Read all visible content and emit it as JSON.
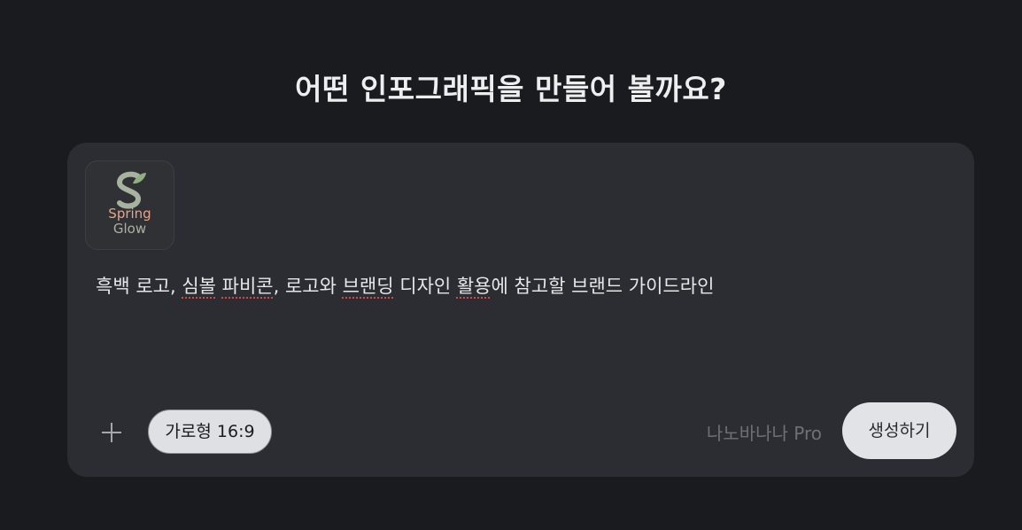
{
  "heading": "어떤 인포그래픽을 만들어 볼까요?",
  "attachment": {
    "logo_line1": "Spring",
    "logo_line2": "Glow",
    "colors": {
      "peach": "#e9a38c",
      "sage": "#a8b2a0",
      "leaf": "#8fb083"
    }
  },
  "prompt": {
    "segments": [
      {
        "text": "흑백 로고, ",
        "misspelled": false
      },
      {
        "text": "심볼",
        "misspelled": true
      },
      {
        "text": " ",
        "misspelled": false
      },
      {
        "text": "파비콘",
        "misspelled": true
      },
      {
        "text": ", 로고와 ",
        "misspelled": false
      },
      {
        "text": "브랜딩",
        "misspelled": true
      },
      {
        "text": " 디자인 ",
        "misspelled": false
      },
      {
        "text": "활용",
        "misspelled": true
      },
      {
        "text": "에 참고할 브랜드 가이드라인",
        "misspelled": false
      }
    ]
  },
  "toolbar": {
    "add_icon": "plus-icon",
    "aspect_label": "가로형 16:9",
    "model_label": "나노바나나 Pro",
    "generate_label": "생성하기"
  }
}
